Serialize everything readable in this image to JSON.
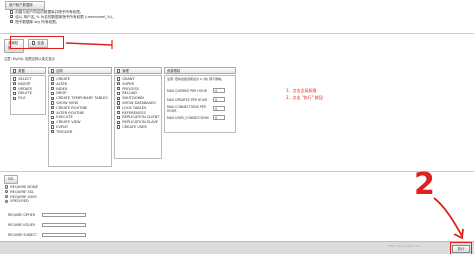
{
  "user_account_section": {
    "legend": "用户帐户数据库",
    "options": [
      {
        "label": "创建与用户同名的数据库并授予所有权限。"
      },
      {
        "label": "给以 用户名_% 为名的数据库授予所有权限 (username\\_%)。"
      },
      {
        "label": "授予数据库 sky 所有权限。"
      }
    ]
  },
  "global_privileges": {
    "legend": "全局权限",
    "check_all_label": "全选",
    "note": "注意: MySQL 权限名称以英文显示",
    "groups": [
      {
        "title": "数据",
        "items": [
          "SELECT",
          "INSERT",
          "UPDATE",
          "DELETE",
          "FILE"
        ]
      },
      {
        "title": "结构",
        "items": [
          "CREATE",
          "ALTER",
          "INDEX",
          "DROP",
          "CREATE TEMPORARY TABLES",
          "SHOW VIEW",
          "CREATE ROUTINE",
          "ALTER ROUTINE",
          "EXECUTE",
          "CREATE VIEW",
          "EVENT",
          "TRIGGER"
        ]
      },
      {
        "title": "管理",
        "items": [
          "GRANT",
          "SUPER",
          "PROCESS",
          "RELOAD",
          "SHUTDOWN",
          "SHOW DATABASES",
          "LOCK TABLES",
          "REFERENCES",
          "REPLICATION CLIENT",
          "REPLICATION SLAVE",
          "CREATE USER"
        ]
      }
    ],
    "resource_limits": {
      "title": "资源限制",
      "note": "注意: 若将这些选项设为 0 (零) 即不限制。",
      "rows": [
        {
          "label": "MAX QUERIES PER HOUR",
          "value": "0"
        },
        {
          "label": "MAX UPDATES PER HOUR",
          "value": "0"
        },
        {
          "label": "MAX CONNECTIONS PER HOUR",
          "value": "0"
        },
        {
          "label": "MAX USER_CONNECTIONS",
          "value": "0"
        }
      ]
    }
  },
  "annotations": {
    "step1": "1、点击全局权限",
    "step2": "2、点击 \"执行\" 按钮",
    "number_2": "2"
  },
  "ssl": {
    "legend": "SSL",
    "options": [
      "REQUIRE NONE",
      "REQUIRE SSL",
      "REQUIRE X509",
      "SPECIFIED"
    ],
    "fields": [
      {
        "label": "REQUIRE CIPHER"
      },
      {
        "label": "REQUIRE ISSUER"
      },
      {
        "label": "REQUIRE SUBJECT"
      }
    ]
  },
  "footer": {
    "go_button": "执行",
    "watermark": "https://blog.csdn.net/..."
  },
  "colors": {
    "annotation_red": "#e0201c",
    "footer_bar": "#dcdcdc"
  }
}
